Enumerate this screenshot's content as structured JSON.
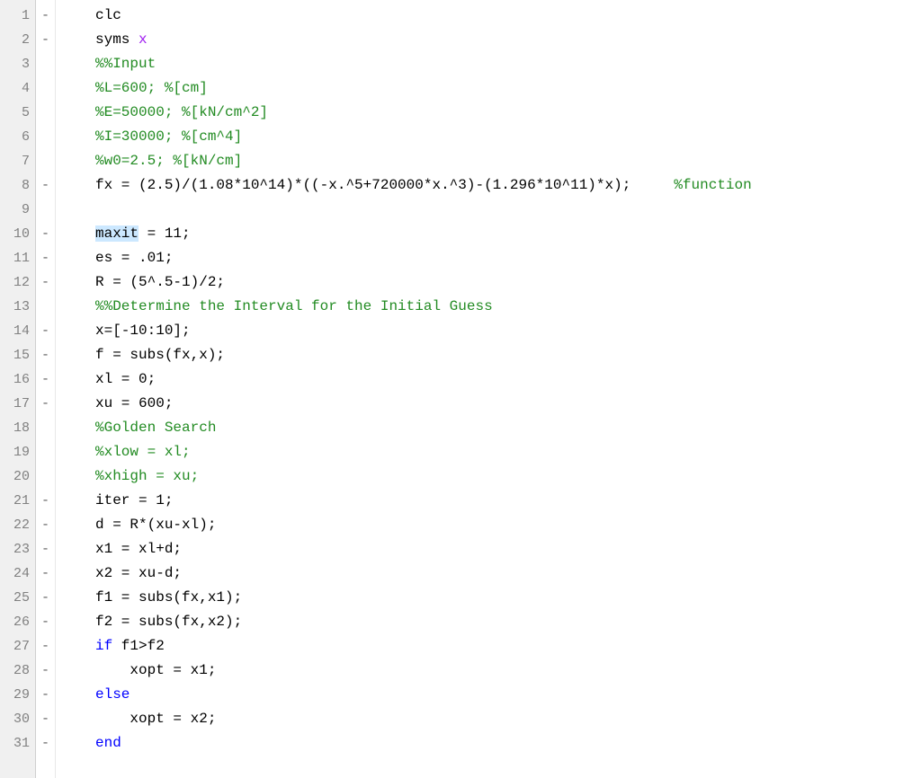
{
  "editor": {
    "lines": [
      {
        "num": 1,
        "bp": "-",
        "tokens": [
          {
            "cls": "tok-default",
            "t": "clc"
          }
        ]
      },
      {
        "num": 2,
        "bp": "-",
        "tokens": [
          {
            "cls": "tok-default",
            "t": "syms "
          },
          {
            "cls": "tok-string",
            "t": "x"
          }
        ]
      },
      {
        "num": 3,
        "bp": "",
        "tokens": [
          {
            "cls": "tok-comment",
            "t": "%%Input"
          }
        ]
      },
      {
        "num": 4,
        "bp": "",
        "tokens": [
          {
            "cls": "tok-comment",
            "t": "%L=600; %[cm]"
          }
        ]
      },
      {
        "num": 5,
        "bp": "",
        "tokens": [
          {
            "cls": "tok-comment",
            "t": "%E=50000; %[kN/cm^2]"
          }
        ]
      },
      {
        "num": 6,
        "bp": "",
        "tokens": [
          {
            "cls": "tok-comment",
            "t": "%I=30000; %[cm^4]"
          }
        ]
      },
      {
        "num": 7,
        "bp": "",
        "tokens": [
          {
            "cls": "tok-comment",
            "t": "%w0=2.5; %[kN/cm]"
          }
        ]
      },
      {
        "num": 8,
        "bp": "-",
        "tokens": [
          {
            "cls": "tok-default",
            "t": "fx = (2.5)/(1.08*10^14)*((-x.^5+720000*x.^3)-(1.296*10^11)*x);     "
          },
          {
            "cls": "tok-comment",
            "t": "%function"
          }
        ]
      },
      {
        "num": 9,
        "bp": "",
        "tokens": [
          {
            "cls": "tok-default",
            "t": ""
          }
        ]
      },
      {
        "num": 10,
        "bp": "-",
        "tokens": [
          {
            "cls": "tok-default highlight",
            "t": "maxit"
          },
          {
            "cls": "tok-default",
            "t": " = 11;"
          }
        ]
      },
      {
        "num": 11,
        "bp": "-",
        "tokens": [
          {
            "cls": "tok-default",
            "t": "es = .01;"
          }
        ]
      },
      {
        "num": 12,
        "bp": "-",
        "tokens": [
          {
            "cls": "tok-default",
            "t": "R = (5^.5-1)/2;"
          }
        ]
      },
      {
        "num": 13,
        "bp": "",
        "tokens": [
          {
            "cls": "tok-comment",
            "t": "%%Determine the Interval for the Initial Guess"
          }
        ]
      },
      {
        "num": 14,
        "bp": "-",
        "tokens": [
          {
            "cls": "tok-default",
            "t": "x=[-10:10];"
          }
        ]
      },
      {
        "num": 15,
        "bp": "-",
        "tokens": [
          {
            "cls": "tok-default",
            "t": "f = subs(fx,x);"
          }
        ]
      },
      {
        "num": 16,
        "bp": "-",
        "tokens": [
          {
            "cls": "tok-default",
            "t": "xl = 0;"
          }
        ]
      },
      {
        "num": 17,
        "bp": "-",
        "tokens": [
          {
            "cls": "tok-default",
            "t": "xu = 600;"
          }
        ]
      },
      {
        "num": 18,
        "bp": "",
        "tokens": [
          {
            "cls": "tok-comment",
            "t": "%Golden Search"
          }
        ]
      },
      {
        "num": 19,
        "bp": "",
        "tokens": [
          {
            "cls": "tok-comment",
            "t": "%xlow = xl;"
          }
        ]
      },
      {
        "num": 20,
        "bp": "",
        "tokens": [
          {
            "cls": "tok-comment",
            "t": "%xhigh = xu;"
          }
        ]
      },
      {
        "num": 21,
        "bp": "-",
        "tokens": [
          {
            "cls": "tok-default",
            "t": "iter = 1;"
          }
        ]
      },
      {
        "num": 22,
        "bp": "-",
        "tokens": [
          {
            "cls": "tok-default",
            "t": "d = R*(xu-xl);"
          }
        ]
      },
      {
        "num": 23,
        "bp": "-",
        "tokens": [
          {
            "cls": "tok-default",
            "t": "x1 = xl+d;"
          }
        ]
      },
      {
        "num": 24,
        "bp": "-",
        "tokens": [
          {
            "cls": "tok-default",
            "t": "x2 = xu-d;"
          }
        ]
      },
      {
        "num": 25,
        "bp": "-",
        "tokens": [
          {
            "cls": "tok-default",
            "t": "f1 = subs(fx,x1);"
          }
        ]
      },
      {
        "num": 26,
        "bp": "-",
        "tokens": [
          {
            "cls": "tok-default",
            "t": "f2 = subs(fx,x2);"
          }
        ]
      },
      {
        "num": 27,
        "bp": "-",
        "tokens": [
          {
            "cls": "tok-keyword",
            "t": "if"
          },
          {
            "cls": "tok-default",
            "t": " f1>f2"
          }
        ]
      },
      {
        "num": 28,
        "bp": "-",
        "tokens": [
          {
            "cls": "tok-default",
            "t": "    xopt = x1;"
          }
        ]
      },
      {
        "num": 29,
        "bp": "-",
        "tokens": [
          {
            "cls": "tok-keyword",
            "t": "else"
          }
        ]
      },
      {
        "num": 30,
        "bp": "-",
        "tokens": [
          {
            "cls": "tok-default",
            "t": "    xopt = x2;"
          }
        ]
      },
      {
        "num": 31,
        "bp": "-",
        "tokens": [
          {
            "cls": "tok-keyword",
            "t": "end"
          }
        ]
      }
    ]
  }
}
